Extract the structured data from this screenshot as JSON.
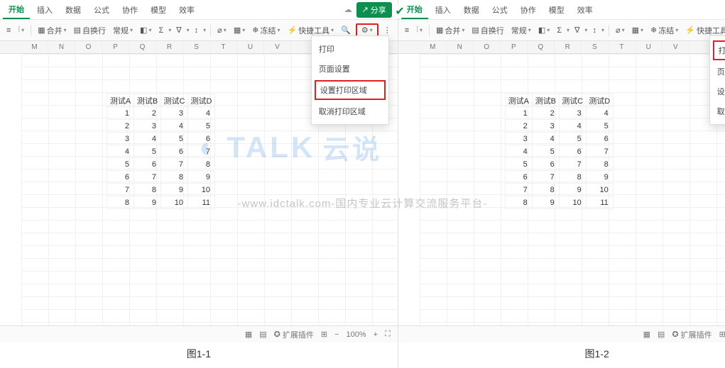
{
  "tabs": {
    "active": "开始",
    "items": [
      "开始",
      "插入",
      "数据",
      "公式",
      "协作",
      "模型",
      "效率"
    ]
  },
  "share_label": "分享",
  "toolbar": {
    "merge": "合并",
    "autofit": "自换行",
    "general": "常规",
    "freeze": "冻结",
    "quick": "快捷工具",
    "sum_icon": "Σ",
    "filter_icon": "∇",
    "sort_icon": "↕",
    "bolt_icon": "⚡"
  },
  "menu": {
    "print": "打印",
    "page_setup": "页面设置",
    "set_area": "设置打印区域",
    "clear_area": "取消打印区域"
  },
  "sheet": {
    "cols": [
      "M",
      "N",
      "O",
      "P",
      "Q",
      "R",
      "S",
      "T",
      "U",
      "V"
    ],
    "headers": [
      "测试A",
      "测试B",
      "测试C",
      "测试D"
    ],
    "rows": [
      [
        1,
        2,
        3,
        4
      ],
      [
        2,
        3,
        4,
        5
      ],
      [
        3,
        4,
        5,
        6
      ],
      [
        4,
        5,
        6,
        7
      ],
      [
        5,
        6,
        7,
        8
      ],
      [
        6,
        7,
        8,
        9
      ],
      [
        7,
        8,
        9,
        10
      ],
      [
        8,
        9,
        10,
        11
      ]
    ]
  },
  "status": {
    "ext": "扩展插件",
    "zoom": "100%"
  },
  "captions": {
    "left": "图1-1",
    "right": "图1-2"
  },
  "watermark": "-www.idctalk.com-国内专业云计算交流服务平台-",
  "logo_text": "TALK",
  "logo_cn": "云说"
}
